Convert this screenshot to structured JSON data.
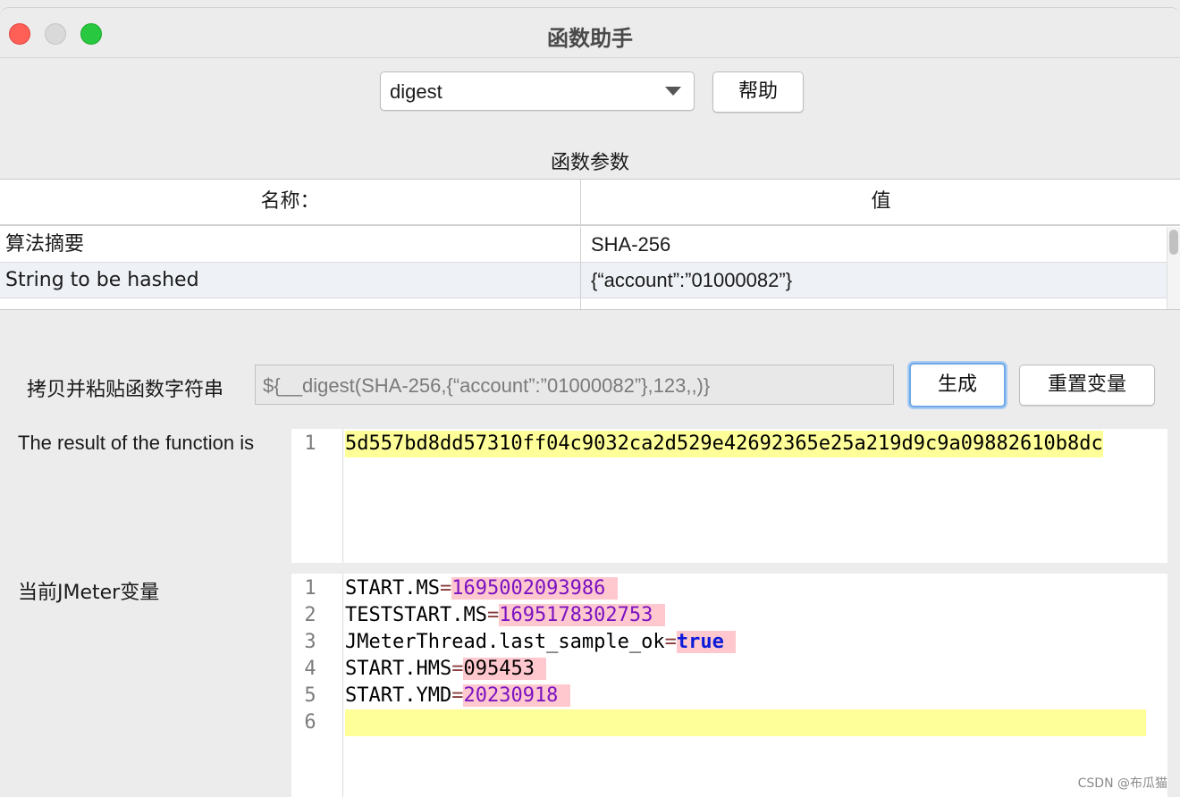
{
  "window": {
    "title": "函数助手"
  },
  "function_select": {
    "value": "digest"
  },
  "help_button": {
    "label": "帮助"
  },
  "params_section": {
    "label": "函数参数"
  },
  "params_table": {
    "headers": [
      "名称：",
      "值"
    ],
    "rows": [
      {
        "name": "算法摘要",
        "value": "SHA-256"
      },
      {
        "name": "String to be hashed",
        "value": "{“account”:”01000082”}"
      }
    ]
  },
  "function_string": {
    "label": "拷贝并粘贴函数字符串",
    "value": "${__digest(SHA-256,{“account”:”01000082”},123,,)}"
  },
  "generate_button": {
    "label": "生成"
  },
  "reset_button": {
    "label": "重置变量"
  },
  "result": {
    "label": "The result of the function is",
    "lines": [
      "5d557bd8dd57310ff04c9032ca2d529e42692365e25a219d9c9a09882610b8dc"
    ]
  },
  "vars": {
    "label": "当前JMeter变量",
    "line_numbers": [
      "1",
      "2",
      "3",
      "4",
      "5",
      "6"
    ],
    "lines": [
      {
        "key": "START.MS",
        "eq": "=",
        "value": "1695002093986"
      },
      {
        "key": "TESTSTART.MS",
        "eq": "=",
        "value": "1695178302753"
      },
      {
        "key": "JMeterThread.last_sample_ok",
        "eq": "=",
        "value": "true"
      },
      {
        "key": "START.HMS",
        "eq": "=",
        "value": "095453"
      },
      {
        "key": "START.YMD",
        "eq": "=",
        "value": "20230918"
      }
    ]
  },
  "watermark": "CSDN @布瓜猫",
  "colors": {
    "highlight_yellow": "#ffff9a",
    "highlight_pink": "#ffc8ce",
    "number": "#7b12c2",
    "keyword": "#0c1bd9",
    "focus_ring": "#6fa8e8"
  }
}
